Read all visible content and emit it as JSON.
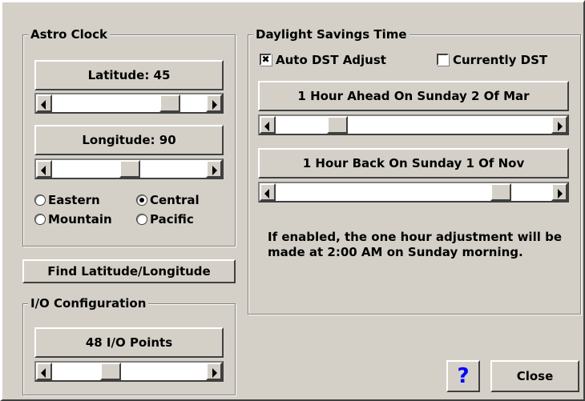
{
  "astro_clock": {
    "title": "Astro Clock",
    "latitude_label": "Latitude: 45",
    "longitude_label": "Longitude: 90",
    "latitude_slider_value": 45,
    "longitude_slider_value": 90,
    "timezones": {
      "eastern": "Eastern",
      "central": "Central",
      "mountain": "Mountain",
      "pacific": "Pacific",
      "selected": "Central"
    }
  },
  "find_button": {
    "label": "Find Latitude/Longitude"
  },
  "io_config": {
    "title": "I/O Configuration",
    "points_label": "48 I/O Points"
  },
  "dst": {
    "title": "Daylight Savings Time",
    "auto_adjust_label": "Auto DST Adjust",
    "auto_adjust_checked": true,
    "auto_adjust_mark": "✖",
    "currently_dst_label": "Currently DST",
    "currently_dst_checked": false,
    "ahead_label": "1 Hour Ahead On Sunday 2 Of Mar",
    "back_label": "1 Hour Back On Sunday 1 Of Nov",
    "note": "If enabled, the one hour adjustment will be made at 2:00 AM on Sunday morning."
  },
  "help_button": {
    "label": "?",
    "color": "#0000ff"
  },
  "close_button": {
    "label": "Close"
  },
  "icons": [
    "scroll-left-arrow-icon",
    "scroll-right-arrow-icon",
    "radio-selected-icon",
    "checkbox-checked-icon",
    "help-icon"
  ]
}
